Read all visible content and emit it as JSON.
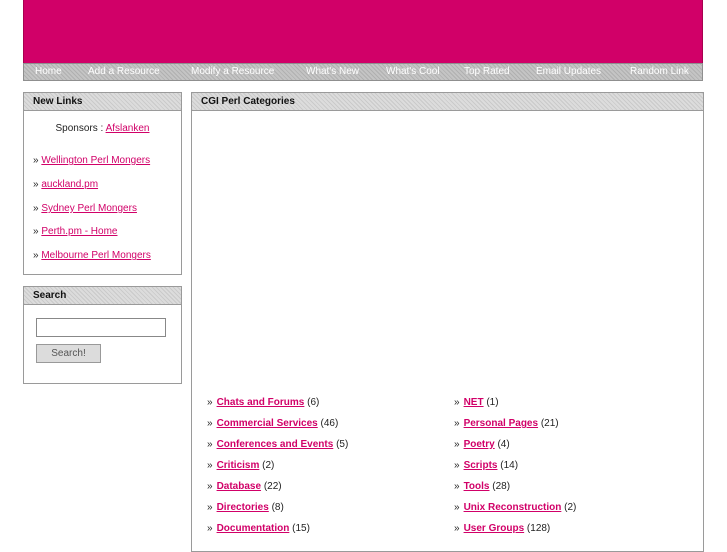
{
  "nav": [
    {
      "label": "Home"
    },
    {
      "label": "Add a Resource"
    },
    {
      "label": "Modify a Resource"
    },
    {
      "label": "What's New"
    },
    {
      "label": "What's Cool"
    },
    {
      "label": "Top Rated"
    },
    {
      "label": "Email Updates"
    },
    {
      "label": "Random Link"
    }
  ],
  "new_links": {
    "title": "New Links",
    "sponsors_label": "Sponsors :",
    "sponsor": "Afslanken",
    "bullet": "»",
    "items": [
      "Wellington Perl Mongers",
      "auckland.pm",
      "Sydney Perl Mongers",
      "Perth.pm - Home",
      "Melbourne Perl Mongers"
    ]
  },
  "search": {
    "title": "Search",
    "input_value": "",
    "button_label": "Search!"
  },
  "categories": {
    "title": "CGI Perl Categories",
    "bullet": "»",
    "left": [
      {
        "name": "Chats and Forums",
        "count": "(6)"
      },
      {
        "name": "Commercial Services",
        "count": "(46)"
      },
      {
        "name": "Conferences and Events",
        "count": "(5)"
      },
      {
        "name": "Criticism",
        "count": "(2)"
      },
      {
        "name": "Database",
        "count": "(22)"
      },
      {
        "name": "Directories",
        "count": "(8)"
      },
      {
        "name": "Documentation",
        "count": "(15)"
      }
    ],
    "right": [
      {
        "name": "NET",
        "count": "(1)"
      },
      {
        "name": "Personal Pages",
        "count": "(21)"
      },
      {
        "name": "Poetry",
        "count": "(4)"
      },
      {
        "name": "Scripts",
        "count": "(14)"
      },
      {
        "name": "Tools",
        "count": "(28)"
      },
      {
        "name": "Unix Reconstruction",
        "count": "(2)"
      },
      {
        "name": "User Groups",
        "count": "(128)"
      }
    ]
  },
  "colors": {
    "brand": "#d10068",
    "nav_bg": "#b8b8b8",
    "box_title_bg": "#d4d4d4"
  }
}
